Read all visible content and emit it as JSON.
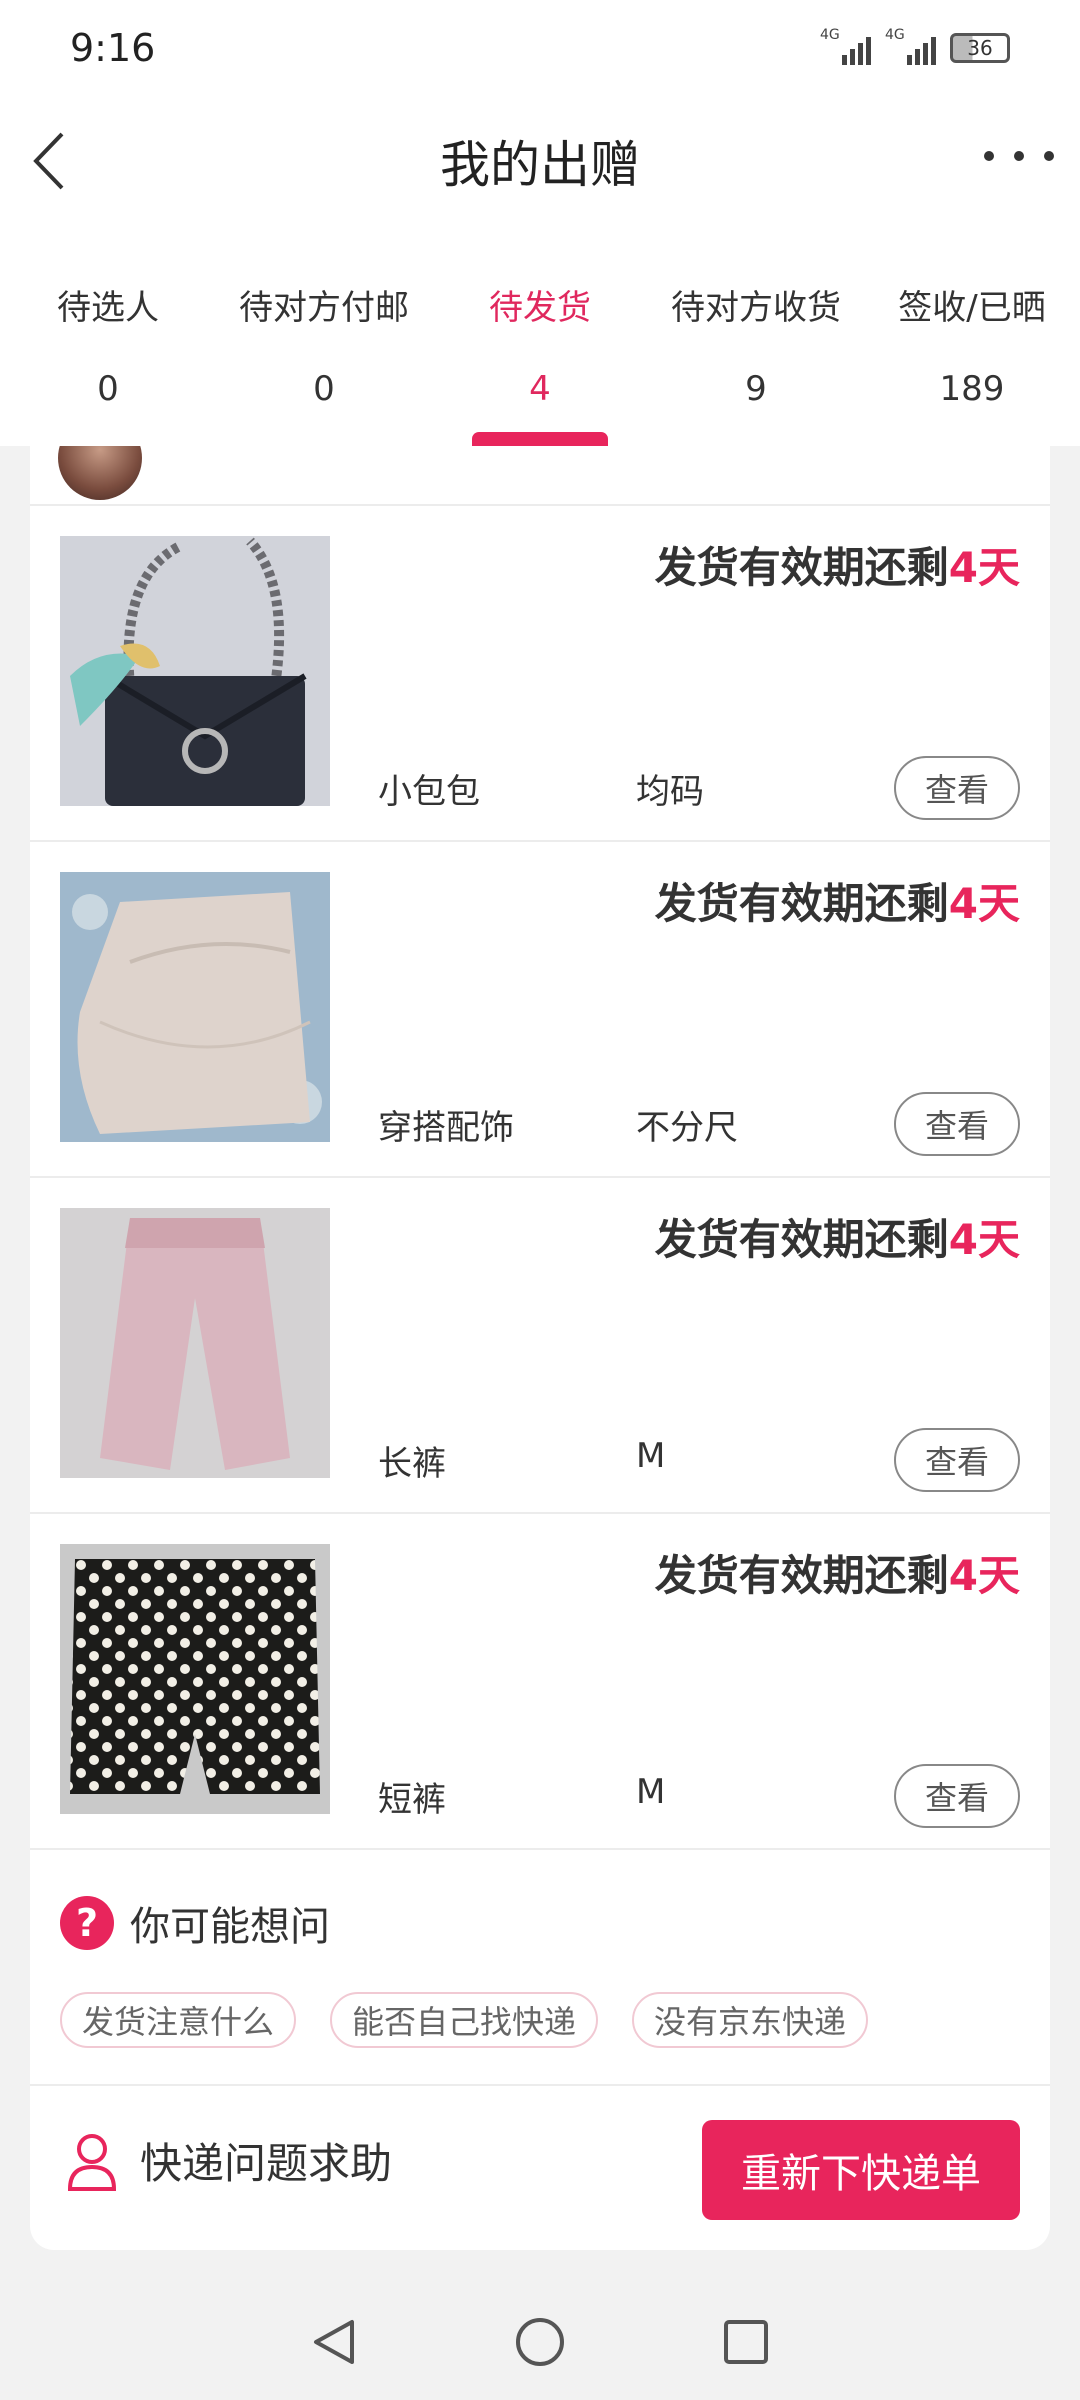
{
  "status_bar": {
    "time": "9:16",
    "network_1": "4G",
    "network_2": "4G",
    "battery": "36"
  },
  "header": {
    "title": "我的出赠"
  },
  "tabs": [
    {
      "label": "待选人",
      "count": "0"
    },
    {
      "label": "待对方付邮",
      "count": "0"
    },
    {
      "label": "待发货",
      "count": "4"
    },
    {
      "label": "待对方收货",
      "count": "9"
    },
    {
      "label": "签收/已晒",
      "count": "189"
    }
  ],
  "active_tab": 2,
  "items": [
    {
      "deadline_prefix": "发货有效期还剩",
      "deadline_days": "4天",
      "name": "小包包",
      "size": "均码",
      "view_label": "查看"
    },
    {
      "deadline_prefix": "发货有效期还剩",
      "deadline_days": "4天",
      "name": "穿搭配饰",
      "size": "不分尺",
      "view_label": "查看"
    },
    {
      "deadline_prefix": "发货有效期还剩",
      "deadline_days": "4天",
      "name": "长裤",
      "size": "M",
      "view_label": "查看"
    },
    {
      "deadline_prefix": "发货有效期还剩",
      "deadline_days": "4天",
      "name": "短裤",
      "size": "M",
      "view_label": "查看"
    }
  ],
  "faq": {
    "icon_text": "?",
    "title": "你可能想问",
    "chips": [
      "发货注意什么",
      "能否自己找快递",
      "没有京东快递"
    ]
  },
  "footer": {
    "help_label": "快递问题求助",
    "reorder_label": "重新下快递单"
  },
  "colors": {
    "accent": "#e8255c",
    "text": "#333333",
    "background": "#f2f2f2"
  },
  "icons": [
    "back-arrow-icon",
    "more-dots-icon",
    "question-icon",
    "person-icon",
    "nav-back-icon",
    "nav-home-icon",
    "nav-recent-icon"
  ]
}
